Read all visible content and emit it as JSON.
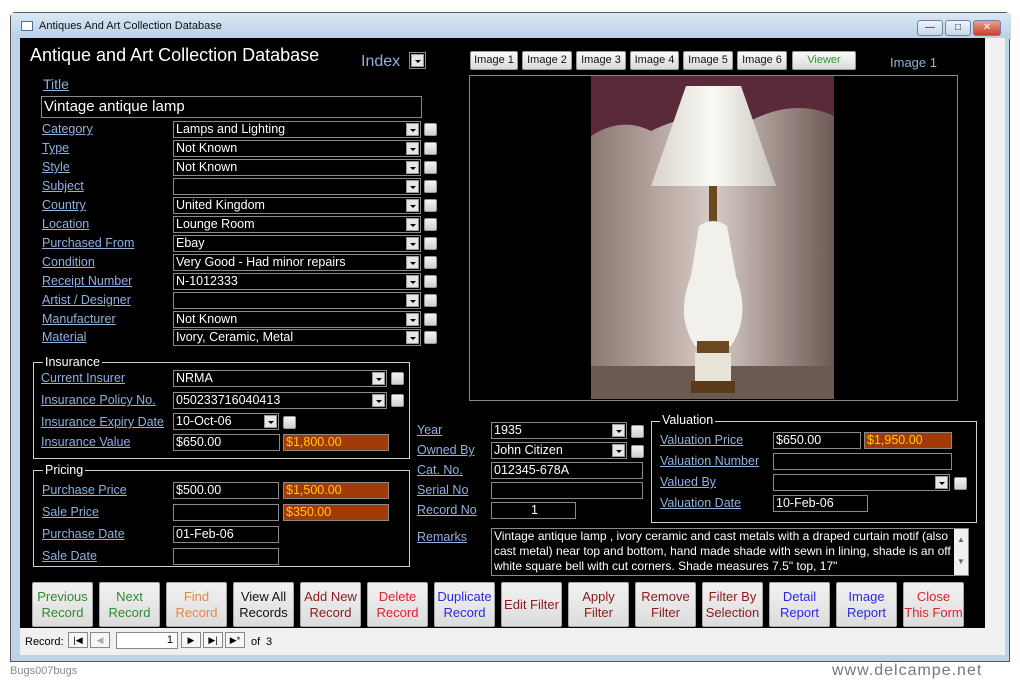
{
  "window": {
    "title": "Antiques And Art Collection Database",
    "minimize": "—",
    "maximize": "□",
    "close": "✕"
  },
  "header": {
    "title": "Antique and Art Collection Database",
    "index_label": "Index"
  },
  "title_field": {
    "label": "Title",
    "value": "Vintage antique lamp"
  },
  "fields": [
    {
      "label": "Category",
      "value": "Lamps and Lighting"
    },
    {
      "label": "Type",
      "value": "Not Known"
    },
    {
      "label": "Style",
      "value": "Not Known"
    },
    {
      "label": "Subject",
      "value": ""
    },
    {
      "label": "Country",
      "value": "United Kingdom"
    },
    {
      "label": "Location",
      "value": "Lounge Room"
    },
    {
      "label": "Purchased From",
      "value": "Ebay"
    },
    {
      "label": "Condition",
      "value": "Very Good - Had minor repairs"
    },
    {
      "label": "Receipt Number",
      "value": "N-1012333"
    },
    {
      "label": "Artist / Designer",
      "value": ""
    },
    {
      "label": "Manufacturer",
      "value": "Not Known"
    },
    {
      "label": "Material",
      "value": "Ivory, Ceramic, Metal"
    }
  ],
  "insurance": {
    "title": "Insurance",
    "current_insurer": {
      "label": "Current Insurer",
      "value": "NRMA"
    },
    "policy_no": {
      "label": "Insurance Policy No.",
      "value": "050233716040413"
    },
    "expiry_date": {
      "label": "Insurance Expiry Date",
      "value": "10-Oct-06"
    },
    "value": {
      "label": "Insurance Value",
      "value": "$650.00",
      "converted": "$1,800.00"
    }
  },
  "pricing": {
    "title": "Pricing",
    "purchase_price": {
      "label": "Purchase Price",
      "value": "$500.00",
      "converted": "$1,500.00"
    },
    "sale_price": {
      "label": "Sale Price",
      "value": "",
      "converted": "$350.00"
    },
    "purchase_date": {
      "label": "Purchase Date",
      "value": "01-Feb-06"
    },
    "sale_date": {
      "label": "Sale Date",
      "value": ""
    }
  },
  "details": {
    "year": {
      "label": "Year",
      "value": "1935"
    },
    "owned_by": {
      "label": "Owned By",
      "value": "John Citizen"
    },
    "cat_no": {
      "label": "Cat. No.",
      "value": "012345-678A"
    },
    "serial_no": {
      "label": "Serial No",
      "value": ""
    },
    "record_no": {
      "label": "Record No",
      "value": "1"
    },
    "remarks": {
      "label": "Remarks",
      "value": "Vintage antique lamp , ivory ceramic and cast metals with a draped curtain motif (also cast metal) near top and bottom, hand made shade with sewn in lining, shade is an off white square bell with cut corners. Shade measures 7.5\" top, 17\""
    }
  },
  "valuation": {
    "title": "Valuation",
    "price": {
      "label": "Valuation Price",
      "value": "$650.00",
      "converted": "$1,950.00"
    },
    "number": {
      "label": "Valuation Number",
      "value": ""
    },
    "valued_by": {
      "label": "Valued By",
      "value": ""
    },
    "date": {
      "label": "Valuation Date",
      "value": "10-Feb-06"
    }
  },
  "image_buttons": [
    "Image 1",
    "Image 2",
    "Image 3",
    "Image 4",
    "Image 5",
    "Image 6",
    "Viewer"
  ],
  "image_label": "Image 1",
  "buttons": [
    {
      "l1": "Previous",
      "l2": "Record",
      "color": "#2e8b2e"
    },
    {
      "l1": "Next",
      "l2": "Record",
      "color": "#2e8b2e"
    },
    {
      "l1": "Find",
      "l2": "Record",
      "color": "#e8873a"
    },
    {
      "l1": "View All",
      "l2": "Records",
      "color": "#111111"
    },
    {
      "l1": "Add New",
      "l2": "Record",
      "color": "#8b1a1a"
    },
    {
      "l1": "Delete",
      "l2": "Record",
      "color": "#e0202a"
    },
    {
      "l1": "Duplicate",
      "l2": "Record",
      "color": "#2a2ae0"
    },
    {
      "l1": "Edit Filter",
      "l2": "",
      "color": "#8b1a1a"
    },
    {
      "l1": "Apply",
      "l2": "Filter",
      "color": "#8b1a1a"
    },
    {
      "l1": "Remove",
      "l2": "Filter",
      "color": "#8b1a1a"
    },
    {
      "l1": "Filter By",
      "l2": "Selection",
      "color": "#8b1a1a"
    },
    {
      "l1": "Detail",
      "l2": "Report",
      "color": "#2a2ae0"
    },
    {
      "l1": "Image",
      "l2": "Report",
      "color": "#2a2ae0"
    },
    {
      "l1": "Close",
      "l2": "This Form",
      "color": "#e0202a"
    }
  ],
  "record_nav": {
    "label": "Record:",
    "current": "1",
    "of": "of",
    "total": "3"
  },
  "footer": {
    "left": "Bugs007bugs",
    "right": "www.delcampe.net"
  }
}
